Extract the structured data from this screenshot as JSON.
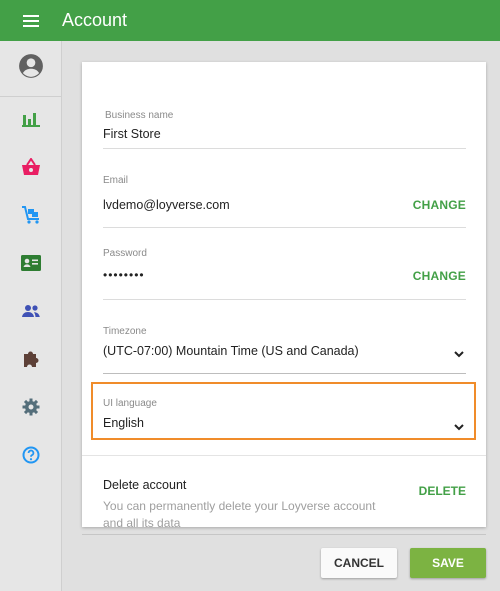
{
  "header": {
    "title": "Account",
    "menu_icon": "hamburger-menu-icon"
  },
  "sidebar": {
    "items": [
      {
        "icon": "account-circle-icon",
        "color": "#616161"
      },
      {
        "icon": "bar-chart-icon",
        "color": "#43a047"
      },
      {
        "icon": "shopping-basket-icon",
        "color": "#e91e63"
      },
      {
        "icon": "inventory-cart-icon",
        "color": "#2196f3"
      },
      {
        "icon": "employee-card-icon",
        "color": "#2e7d32"
      },
      {
        "icon": "customers-icon",
        "color": "#3f51b5"
      },
      {
        "icon": "integrations-puzzle-icon",
        "color": "#5d4037"
      },
      {
        "icon": "settings-gear-icon",
        "color": "#546e7a"
      },
      {
        "icon": "help-circle-icon",
        "color": "#2196f3"
      }
    ]
  },
  "form": {
    "business_name": {
      "label": "Business name",
      "value": "First Store"
    },
    "email": {
      "label": "Email",
      "value": "lvdemo@loyverse.com",
      "action": "CHANGE"
    },
    "password": {
      "label": "Password",
      "value": "••••••••",
      "action": "CHANGE"
    },
    "timezone": {
      "label": "Timezone",
      "value": "(UTC-07:00) Mountain Time (US and Canada)"
    },
    "ui_language": {
      "label": "UI language",
      "value": "English"
    }
  },
  "delete_account": {
    "title": "Delete account",
    "description": "You can permanently delete your Loyverse account and all its data",
    "action": "DELETE"
  },
  "buttons": {
    "cancel": "CANCEL",
    "save": "SAVE"
  },
  "colors": {
    "accent": "#43a047",
    "highlight": "#f08c2a",
    "save_button": "#7cb342"
  }
}
